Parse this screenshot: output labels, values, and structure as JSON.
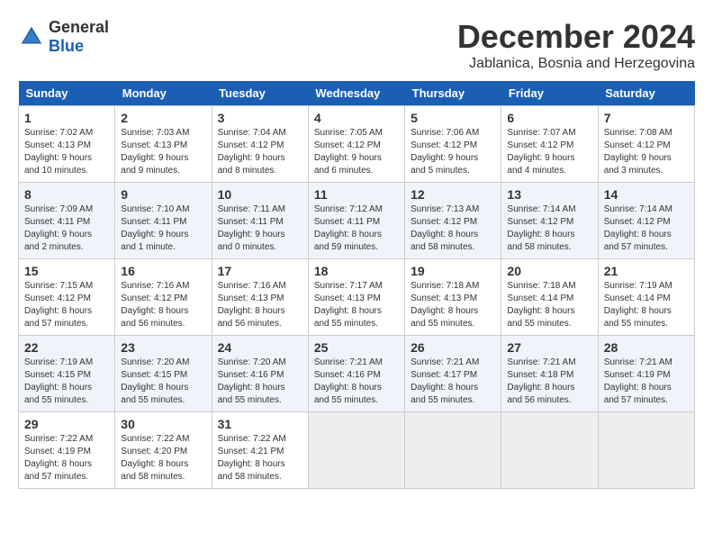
{
  "header": {
    "logo_general": "General",
    "logo_blue": "Blue",
    "month": "December 2024",
    "location": "Jablanica, Bosnia and Herzegovina"
  },
  "weekdays": [
    "Sunday",
    "Monday",
    "Tuesday",
    "Wednesday",
    "Thursday",
    "Friday",
    "Saturday"
  ],
  "weeks": [
    [
      {
        "day": "1",
        "sunrise": "Sunrise: 7:02 AM",
        "sunset": "Sunset: 4:13 PM",
        "daylight": "Daylight: 9 hours and 10 minutes."
      },
      {
        "day": "2",
        "sunrise": "Sunrise: 7:03 AM",
        "sunset": "Sunset: 4:13 PM",
        "daylight": "Daylight: 9 hours and 9 minutes."
      },
      {
        "day": "3",
        "sunrise": "Sunrise: 7:04 AM",
        "sunset": "Sunset: 4:12 PM",
        "daylight": "Daylight: 9 hours and 8 minutes."
      },
      {
        "day": "4",
        "sunrise": "Sunrise: 7:05 AM",
        "sunset": "Sunset: 4:12 PM",
        "daylight": "Daylight: 9 hours and 6 minutes."
      },
      {
        "day": "5",
        "sunrise": "Sunrise: 7:06 AM",
        "sunset": "Sunset: 4:12 PM",
        "daylight": "Daylight: 9 hours and 5 minutes."
      },
      {
        "day": "6",
        "sunrise": "Sunrise: 7:07 AM",
        "sunset": "Sunset: 4:12 PM",
        "daylight": "Daylight: 9 hours and 4 minutes."
      },
      {
        "day": "7",
        "sunrise": "Sunrise: 7:08 AM",
        "sunset": "Sunset: 4:12 PM",
        "daylight": "Daylight: 9 hours and 3 minutes."
      }
    ],
    [
      {
        "day": "8",
        "sunrise": "Sunrise: 7:09 AM",
        "sunset": "Sunset: 4:11 PM",
        "daylight": "Daylight: 9 hours and 2 minutes."
      },
      {
        "day": "9",
        "sunrise": "Sunrise: 7:10 AM",
        "sunset": "Sunset: 4:11 PM",
        "daylight": "Daylight: 9 hours and 1 minute."
      },
      {
        "day": "10",
        "sunrise": "Sunrise: 7:11 AM",
        "sunset": "Sunset: 4:11 PM",
        "daylight": "Daylight: 9 hours and 0 minutes."
      },
      {
        "day": "11",
        "sunrise": "Sunrise: 7:12 AM",
        "sunset": "Sunset: 4:11 PM",
        "daylight": "Daylight: 8 hours and 59 minutes."
      },
      {
        "day": "12",
        "sunrise": "Sunrise: 7:13 AM",
        "sunset": "Sunset: 4:12 PM",
        "daylight": "Daylight: 8 hours and 58 minutes."
      },
      {
        "day": "13",
        "sunrise": "Sunrise: 7:14 AM",
        "sunset": "Sunset: 4:12 PM",
        "daylight": "Daylight: 8 hours and 58 minutes."
      },
      {
        "day": "14",
        "sunrise": "Sunrise: 7:14 AM",
        "sunset": "Sunset: 4:12 PM",
        "daylight": "Daylight: 8 hours and 57 minutes."
      }
    ],
    [
      {
        "day": "15",
        "sunrise": "Sunrise: 7:15 AM",
        "sunset": "Sunset: 4:12 PM",
        "daylight": "Daylight: 8 hours and 57 minutes."
      },
      {
        "day": "16",
        "sunrise": "Sunrise: 7:16 AM",
        "sunset": "Sunset: 4:12 PM",
        "daylight": "Daylight: 8 hours and 56 minutes."
      },
      {
        "day": "17",
        "sunrise": "Sunrise: 7:16 AM",
        "sunset": "Sunset: 4:13 PM",
        "daylight": "Daylight: 8 hours and 56 minutes."
      },
      {
        "day": "18",
        "sunrise": "Sunrise: 7:17 AM",
        "sunset": "Sunset: 4:13 PM",
        "daylight": "Daylight: 8 hours and 55 minutes."
      },
      {
        "day": "19",
        "sunrise": "Sunrise: 7:18 AM",
        "sunset": "Sunset: 4:13 PM",
        "daylight": "Daylight: 8 hours and 55 minutes."
      },
      {
        "day": "20",
        "sunrise": "Sunrise: 7:18 AM",
        "sunset": "Sunset: 4:14 PM",
        "daylight": "Daylight: 8 hours and 55 minutes."
      },
      {
        "day": "21",
        "sunrise": "Sunrise: 7:19 AM",
        "sunset": "Sunset: 4:14 PM",
        "daylight": "Daylight: 8 hours and 55 minutes."
      }
    ],
    [
      {
        "day": "22",
        "sunrise": "Sunrise: 7:19 AM",
        "sunset": "Sunset: 4:15 PM",
        "daylight": "Daylight: 8 hours and 55 minutes."
      },
      {
        "day": "23",
        "sunrise": "Sunrise: 7:20 AM",
        "sunset": "Sunset: 4:15 PM",
        "daylight": "Daylight: 8 hours and 55 minutes."
      },
      {
        "day": "24",
        "sunrise": "Sunrise: 7:20 AM",
        "sunset": "Sunset: 4:16 PM",
        "daylight": "Daylight: 8 hours and 55 minutes."
      },
      {
        "day": "25",
        "sunrise": "Sunrise: 7:21 AM",
        "sunset": "Sunset: 4:16 PM",
        "daylight": "Daylight: 8 hours and 55 minutes."
      },
      {
        "day": "26",
        "sunrise": "Sunrise: 7:21 AM",
        "sunset": "Sunset: 4:17 PM",
        "daylight": "Daylight: 8 hours and 55 minutes."
      },
      {
        "day": "27",
        "sunrise": "Sunrise: 7:21 AM",
        "sunset": "Sunset: 4:18 PM",
        "daylight": "Daylight: 8 hours and 56 minutes."
      },
      {
        "day": "28",
        "sunrise": "Sunrise: 7:21 AM",
        "sunset": "Sunset: 4:19 PM",
        "daylight": "Daylight: 8 hours and 57 minutes."
      }
    ],
    [
      {
        "day": "29",
        "sunrise": "Sunrise: 7:22 AM",
        "sunset": "Sunset: 4:19 PM",
        "daylight": "Daylight: 8 hours and 57 minutes."
      },
      {
        "day": "30",
        "sunrise": "Sunrise: 7:22 AM",
        "sunset": "Sunset: 4:20 PM",
        "daylight": "Daylight: 8 hours and 58 minutes."
      },
      {
        "day": "31",
        "sunrise": "Sunrise: 7:22 AM",
        "sunset": "Sunset: 4:21 PM",
        "daylight": "Daylight: 8 hours and 58 minutes."
      },
      null,
      null,
      null,
      null
    ]
  ]
}
